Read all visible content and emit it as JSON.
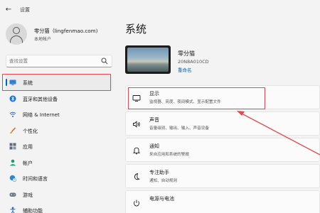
{
  "window": {
    "title": "设置",
    "back_label": "←"
  },
  "user": {
    "name": "零分猫（lingfenmao.com)",
    "account_type": "本地帐户"
  },
  "search": {
    "placeholder": "查找设置"
  },
  "sidebar": {
    "items": [
      {
        "label": "系统",
        "icon": "monitor-icon",
        "active": true
      },
      {
        "label": "蓝牙和其他设备",
        "icon": "bluetooth-icon"
      },
      {
        "label": "网络 & Internet",
        "icon": "network-icon"
      },
      {
        "label": "个性化",
        "icon": "brush-icon"
      },
      {
        "label": "应用",
        "icon": "apps-icon"
      },
      {
        "label": "帐户",
        "icon": "account-icon"
      },
      {
        "label": "时间和语言",
        "icon": "globe-clock-icon"
      },
      {
        "label": "游戏",
        "icon": "gamepad-icon"
      },
      {
        "label": "辅助功能",
        "icon": "accessibility-icon"
      }
    ]
  },
  "main": {
    "title": "系统",
    "device": {
      "name": "零分猫",
      "model": "20N8A010CD",
      "rename": "重命名"
    },
    "cards": [
      {
        "title": "显示",
        "desc": "监视器、亮度、夜间模式、显示配置文件",
        "icon": "display-icon"
      },
      {
        "title": "声音",
        "desc": "音量级别、输出、输入、声音设备",
        "icon": "speaker-icon"
      },
      {
        "title": "通知",
        "desc": "来自应用和系统的警报",
        "icon": "bell-icon"
      },
      {
        "title": "专注助手",
        "desc": "通知、自动规则",
        "icon": "moon-icon"
      },
      {
        "title": "电源与电池",
        "desc": "",
        "icon": "power-icon"
      }
    ]
  },
  "colors": {
    "accent": "#0067c0",
    "highlight": "#e5484d",
    "background": "#f3f3f3"
  }
}
